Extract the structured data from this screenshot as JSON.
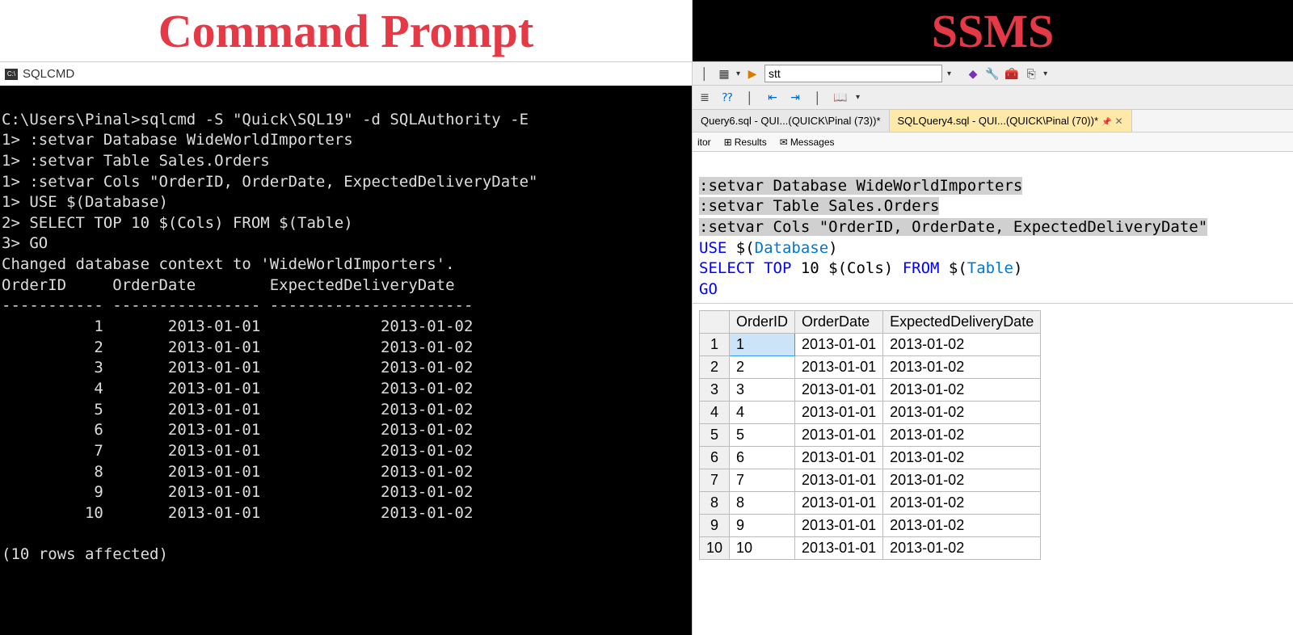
{
  "left": {
    "header": "Command Prompt",
    "titlebar": "SQLCMD",
    "prompt_line": "C:\\Users\\Pinal>sqlcmd -S \"Quick\\SQL19\" -d SQLAuthority -E",
    "lines": [
      "1> :setvar Database WideWorldImporters",
      "1> :setvar Table Sales.Orders",
      "1> :setvar Cols \"OrderID, OrderDate, ExpectedDeliveryDate\"",
      "1> USE $(Database)",
      "2> SELECT TOP 10 $(Cols) FROM $(Table)",
      "3> GO"
    ],
    "changed_msg": "Changed database context to 'WideWorldImporters'.",
    "header_row": "OrderID     OrderDate        ExpectedDeliveryDate",
    "divider": "----------- ---------------- ----------------------",
    "rows": [
      "          1       2013-01-01             2013-01-02",
      "          2       2013-01-01             2013-01-02",
      "          3       2013-01-01             2013-01-02",
      "          4       2013-01-01             2013-01-02",
      "          5       2013-01-01             2013-01-02",
      "          6       2013-01-01             2013-01-02",
      "          7       2013-01-01             2013-01-02",
      "          8       2013-01-01             2013-01-02",
      "          9       2013-01-01             2013-01-02",
      "         10       2013-01-01             2013-01-02"
    ],
    "footer": "(10 rows affected)"
  },
  "right": {
    "header": "SSMS",
    "toolbar_input": "stt",
    "tabs": [
      {
        "label": "Query6.sql - QUI...(QUICK\\Pinal (73))*",
        "active": false
      },
      {
        "label": "SQLQuery4.sql - QUI...(QUICK\\Pinal (70))*",
        "active": true
      }
    ],
    "subtabs": {
      "editor": "itor",
      "results": "Results",
      "messages": "Messages"
    },
    "editor": {
      "l1": ":setvar Database WideWorldImporters",
      "l2": ":setvar Table Sales.Orders",
      "l3": ":setvar Cols \"OrderID, OrderDate, ExpectedDeliveryDate\"",
      "l4a": "USE",
      "l4b": " $(",
      "l4c": "Database",
      "l4d": ")",
      "l5a": "SELECT",
      "l5b": " TOP",
      "l5c": " 10 $(Cols) ",
      "l5d": "FROM",
      "l5e": " $(",
      "l5f": "Table",
      "l5g": ")",
      "l6": "GO"
    },
    "grid": {
      "columns": [
        "",
        "OrderID",
        "OrderDate",
        "ExpectedDeliveryDate"
      ],
      "rows": [
        [
          "1",
          "1",
          "2013-01-01",
          "2013-01-02"
        ],
        [
          "2",
          "2",
          "2013-01-01",
          "2013-01-02"
        ],
        [
          "3",
          "3",
          "2013-01-01",
          "2013-01-02"
        ],
        [
          "4",
          "4",
          "2013-01-01",
          "2013-01-02"
        ],
        [
          "5",
          "5",
          "2013-01-01",
          "2013-01-02"
        ],
        [
          "6",
          "6",
          "2013-01-01",
          "2013-01-02"
        ],
        [
          "7",
          "7",
          "2013-01-01",
          "2013-01-02"
        ],
        [
          "8",
          "8",
          "2013-01-01",
          "2013-01-02"
        ],
        [
          "9",
          "9",
          "2013-01-01",
          "2013-01-02"
        ],
        [
          "10",
          "10",
          "2013-01-01",
          "2013-01-02"
        ]
      ]
    }
  }
}
